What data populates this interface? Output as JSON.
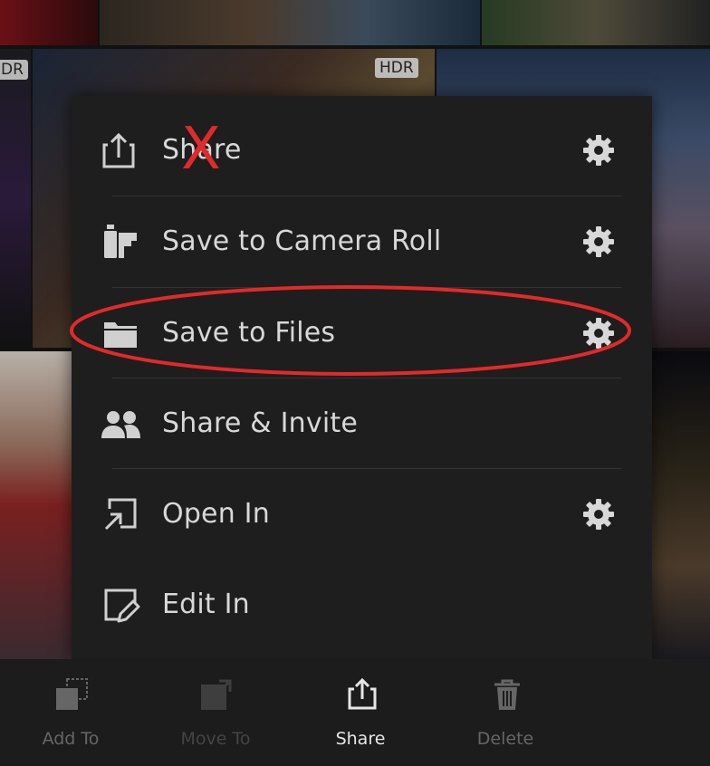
{
  "photos": {
    "hdr_badges": [
      "DR",
      "HDR"
    ]
  },
  "menu": {
    "items": [
      {
        "label": "Share",
        "has_settings": true,
        "icon": "share-icon"
      },
      {
        "label": "Save to Camera Roll",
        "has_settings": true,
        "icon": "camera-roll-icon"
      },
      {
        "label": "Save to Files",
        "has_settings": true,
        "icon": "folder-icon"
      },
      {
        "label": "Share & Invite",
        "has_settings": false,
        "icon": "people-icon"
      },
      {
        "label": "Open In",
        "has_settings": true,
        "icon": "open-in-icon"
      },
      {
        "label": "Edit In",
        "has_settings": false,
        "icon": "edit-in-icon"
      }
    ]
  },
  "annotations": {
    "cross_out_mark": "X",
    "highlight_color": "#e12a2a"
  },
  "toolbar": {
    "items": [
      {
        "label": "Add To",
        "state": "normal",
        "icon": "add-to-icon"
      },
      {
        "label": "Move To",
        "state": "disabled",
        "icon": "move-to-icon"
      },
      {
        "label": "Share",
        "state": "active",
        "icon": "share-icon"
      },
      {
        "label": "Delete",
        "state": "normal",
        "icon": "trash-icon"
      }
    ]
  }
}
